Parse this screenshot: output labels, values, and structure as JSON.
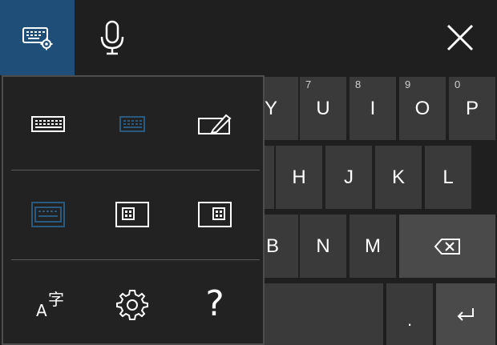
{
  "topbar": {
    "settings_icon": "keyboard-settings-icon",
    "mic_icon": "microphone-icon",
    "close_icon": "close-icon"
  },
  "keys": {
    "row1": [
      {
        "label": "Y",
        "sub": ""
      },
      {
        "label": "U",
        "sub": "7"
      },
      {
        "label": "I",
        "sub": "8"
      },
      {
        "label": "O",
        "sub": "9"
      },
      {
        "label": "P",
        "sub": "0"
      }
    ],
    "row2": [
      {
        "label": "H"
      },
      {
        "label": "J"
      },
      {
        "label": "K"
      },
      {
        "label": "L"
      }
    ],
    "row3": [
      {
        "label": "B"
      },
      {
        "label": "N"
      },
      {
        "label": "M"
      }
    ],
    "row4": {
      "period": ".",
      "enter_icon": "enter-icon"
    },
    "backspace_icon": "backspace-icon"
  },
  "panel": {
    "row1": [
      "full-keyboard-icon",
      "small-keyboard-icon",
      "handwriting-icon"
    ],
    "row2": [
      "docked-keyboard-icon",
      "undock-left-icon",
      "undock-right-icon"
    ],
    "row3": [
      "language-icon",
      "settings-gear-icon",
      "help-icon"
    ],
    "help_glyph": "?"
  },
  "colors": {
    "accent": "#1f4f79",
    "key_bg": "#3a3a3a",
    "key_dark_bg": "#4a4a4a",
    "panel_bg": "#222222",
    "inactive_icon": "#2a5a80"
  }
}
